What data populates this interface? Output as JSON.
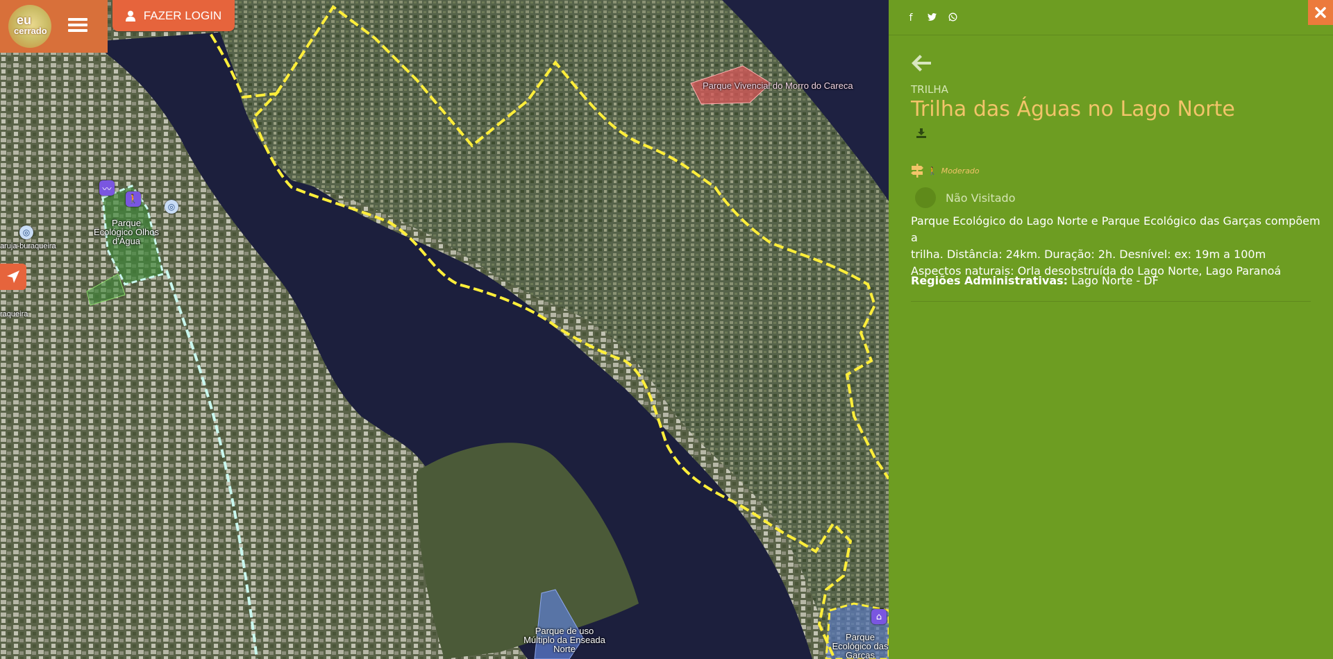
{
  "header": {
    "logo_line1": "eu",
    "logo_line2": "cerrado",
    "login_label": "FAZER LOGIN"
  },
  "map": {
    "labels": {
      "parque_vivencial": "Parque Vivencial do Morro do Careca",
      "parque_olhos": "Parque Ecológico Olhos d'Água",
      "parque_enseada": "Parque de uso Múltiplo da Enseada Norte",
      "parque_garcas": "Parque Ecológico das Garças",
      "street_1": "aruja-buraqueira",
      "street_2": "raqueira"
    },
    "colors": {
      "trail": "#ffee3a",
      "trail_alt": "#c9f7ee",
      "water": "#1c1f3d",
      "land": "#4b5a38",
      "park_green": "#3f8a3a",
      "park_red": "#d9575a",
      "park_blue": "#5e7fd6"
    }
  },
  "panel": {
    "share_icons": [
      "facebook-icon",
      "twitter-icon",
      "whatsapp-icon"
    ],
    "eyebrow": "TRILHA",
    "title": "Trilha das Águas no Lago Norte",
    "difficulty": "Moderado",
    "visited_label": "Não Visitado",
    "description": [
      "Parque Ecológico do Lago Norte e Parque Ecológico das Garças compõem a",
      "trilha. Distância: 24km. Duração: 2h. Desnível: ex: 19m a 100m",
      "Aspectos naturais: Orla desobstruída do Lago Norte, Lago Paranoá"
    ],
    "regions_label": "Regiões Administrativas:",
    "regions_value": "Lago Norte - DF",
    "colors": {
      "background": "#6d9d22",
      "title": "#f2c46a",
      "close": "#ec7a3c"
    }
  }
}
